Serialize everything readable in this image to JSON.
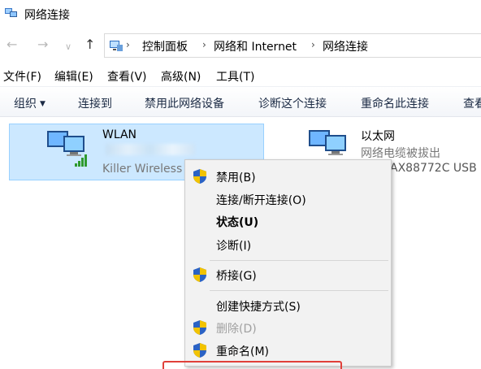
{
  "window": {
    "title": "网络连接",
    "icon": "network-connections-icon"
  },
  "nav": {
    "back_icon": "←",
    "forward_icon": "→",
    "recent_icon": "∨",
    "up_icon": "↑",
    "separator": "›",
    "breadcrumb": [
      "控制面板",
      "网络和 Internet",
      "网络连接"
    ]
  },
  "menu": [
    "文件(F)",
    "编辑(E)",
    "查看(V)",
    "高级(N)",
    "工具(T)"
  ],
  "toolbar": [
    "组织",
    "连接到",
    "禁用此网络设备",
    "诊断这个连接",
    "重命名此连接",
    "查看"
  ],
  "toolbar_caret": "▼",
  "adapters": [
    {
      "name": "WLAN",
      "status": "",
      "device": "Killer Wireless"
    },
    {
      "name": "以太网",
      "status": "网络电缆被拔出",
      "device": "AX88772C USB"
    }
  ],
  "context_menu": {
    "items": [
      {
        "label": "禁用(B)",
        "shield": true,
        "bold": false,
        "disabled": false
      },
      {
        "label": "连接/断开连接(O)",
        "shield": false,
        "bold": false,
        "disabled": false
      },
      {
        "label": "状态(U)",
        "shield": false,
        "bold": true,
        "disabled": false
      },
      {
        "label": "诊断(I)",
        "shield": false,
        "bold": false,
        "disabled": false
      },
      {
        "label": "桥接(G)",
        "shield": true,
        "bold": false,
        "disabled": false
      },
      {
        "label": "创建快捷方式(S)",
        "shield": false,
        "bold": false,
        "disabled": false
      },
      {
        "label": "删除(D)",
        "shield": true,
        "bold": false,
        "disabled": true
      },
      {
        "label": "重命名(M)",
        "shield": true,
        "bold": false,
        "disabled": false
      }
    ]
  },
  "colors": {
    "selection_bg": "#cce8ff",
    "selection_border": "#99d1ff",
    "highlight_red": "#e0403a",
    "menu_bg": "#f2f2f2"
  }
}
